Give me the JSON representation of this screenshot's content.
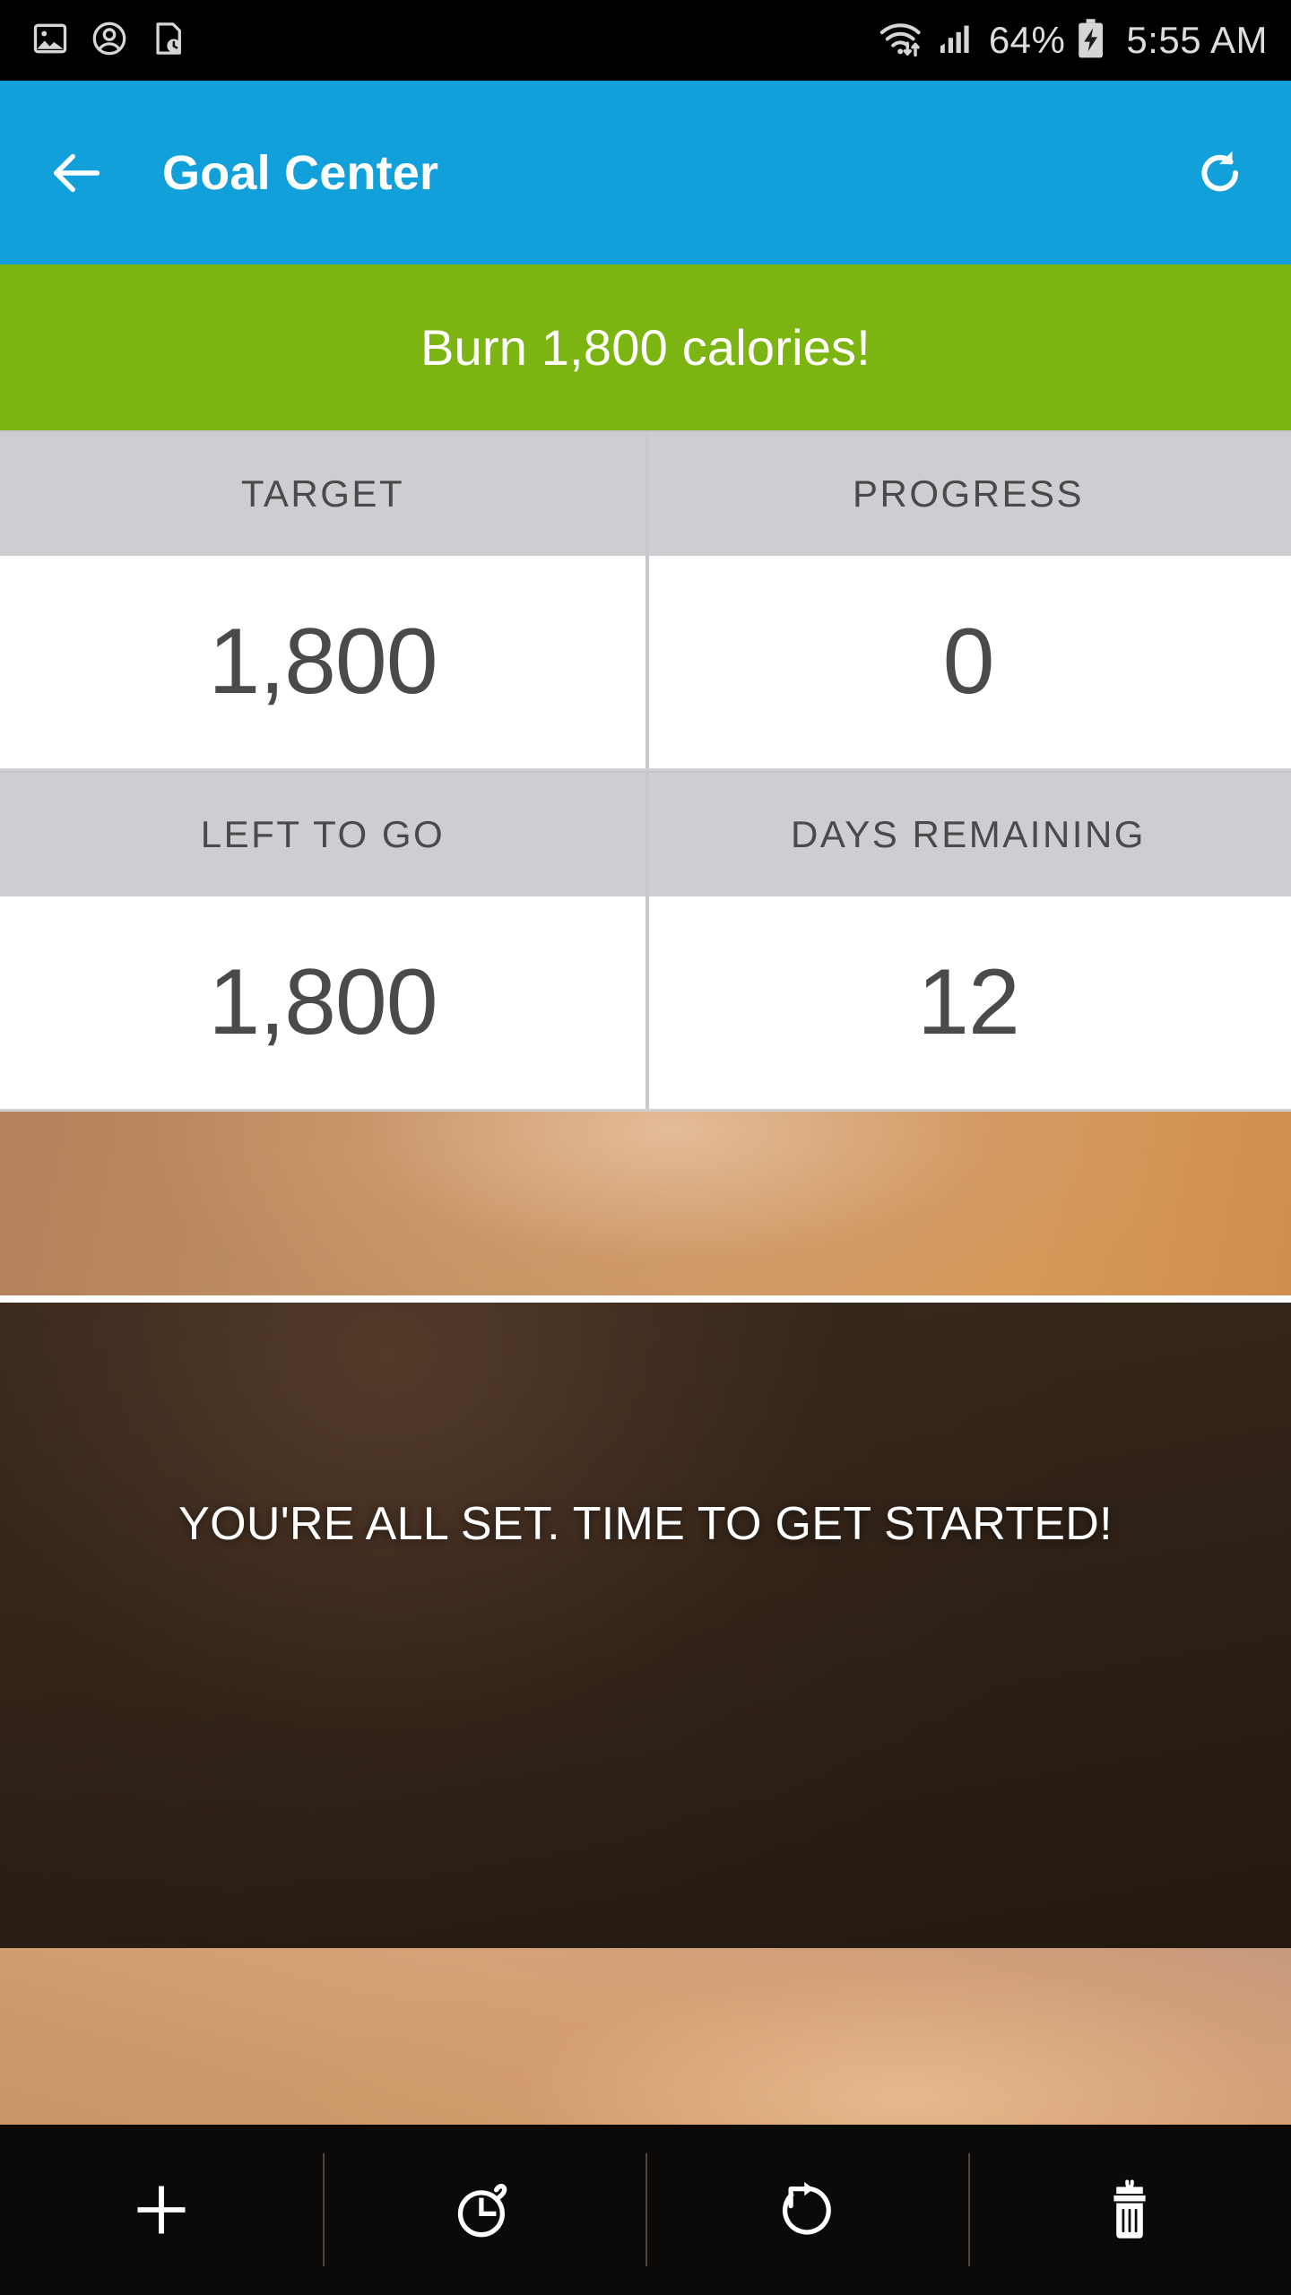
{
  "statusbar": {
    "notification_icons": [
      "image-icon",
      "account-circle-icon",
      "document-clock-icon"
    ],
    "wifi_icon": "wifi-data-transfer-icon",
    "signal_icon": "cellular-signal-icon",
    "battery_percent": "64%",
    "battery_icon": "battery-charging-icon",
    "time": "5:55 AM"
  },
  "appbar": {
    "back_icon": "back-arrow-icon",
    "title": "Goal Center",
    "refresh_icon": "refresh-icon",
    "background_color": "#12a0da"
  },
  "banner": {
    "text": "Burn 1,800 calories!",
    "background_color": "#7cb511"
  },
  "stats": {
    "header_background": "#cdced2",
    "value_color": "#4a4a4a",
    "rows": [
      {
        "cells": [
          {
            "label": "TARGET",
            "value": "1,800"
          },
          {
            "label": "PROGRESS",
            "value": "0"
          }
        ]
      },
      {
        "cells": [
          {
            "label": "LEFT TO GO",
            "value": "1,800"
          },
          {
            "label": "DAYS REMAINING",
            "value": "12"
          }
        ]
      }
    ]
  },
  "photo": {
    "message": "YOU'RE ALL SET. TIME TO GET STARTED!"
  },
  "toolbar": {
    "background_color": "#0c0a09",
    "items": [
      {
        "name": "add",
        "icon": "plus-icon"
      },
      {
        "name": "timer",
        "icon": "stopwatch-icon"
      },
      {
        "name": "reset",
        "icon": "rotate-restart-icon"
      },
      {
        "name": "delete",
        "icon": "trash-icon"
      }
    ]
  }
}
